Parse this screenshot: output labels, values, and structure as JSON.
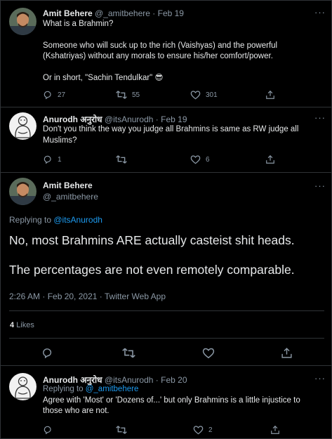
{
  "tweet1": {
    "name": "Amit Behere",
    "handle": "@_amitbehere",
    "dot": "·",
    "date": "Feb 19",
    "line1": "What is a Brahmin?",
    "line2": "Someone who will suck up to the rich (Vaishyas) and the powerful",
    "line3": "(Kshatriyas) without any morals to ensure his/her comfort/power.",
    "line4": "Or in short, \"Sachin Tendulkar\"",
    "emoji": "😎",
    "replies": "27",
    "retweets": "55",
    "likes": "301"
  },
  "tweet2": {
    "name": "Anurodh अनुरोध",
    "handle": "@itsAnurodh",
    "dot": "·",
    "date": "Feb 19",
    "line1": "Don't you think the way you judge all Brahmins is same as RW judge all",
    "line2": "Muslims?",
    "replies": "1",
    "retweets": "",
    "likes": "6"
  },
  "main": {
    "name": "Amit Behere",
    "handle": "@_amitbehere",
    "replying_prefix": "Replying to ",
    "replying_handle": "@itsAnurodh",
    "line1": "No, most Brahmins ARE actually casteist shit heads.",
    "line2": "The percentages are not even remotely comparable.",
    "timestamp": "2:26 AM · Feb 20, 2021 · Twitter Web App",
    "likes_count": "4",
    "likes_label": "Likes"
  },
  "tweet3": {
    "name": "Anurodh अनुरोध",
    "handle": "@itsAnurodh",
    "dot": "·",
    "date": "Feb 20",
    "replying_prefix": "Replying to ",
    "replying_handle": "@_amitbehere",
    "line1": "Agree with 'Most' or 'Dozens of...' but only Brahmins is a little injustice to",
    "line2": "those who are not.",
    "replies": "",
    "retweets": "",
    "likes": "2"
  },
  "more_label": "···",
  "colors": {
    "background": "#000000",
    "link": "#1d9bf0",
    "muted": "#8b98a5",
    "text": "#e7e9ea"
  }
}
